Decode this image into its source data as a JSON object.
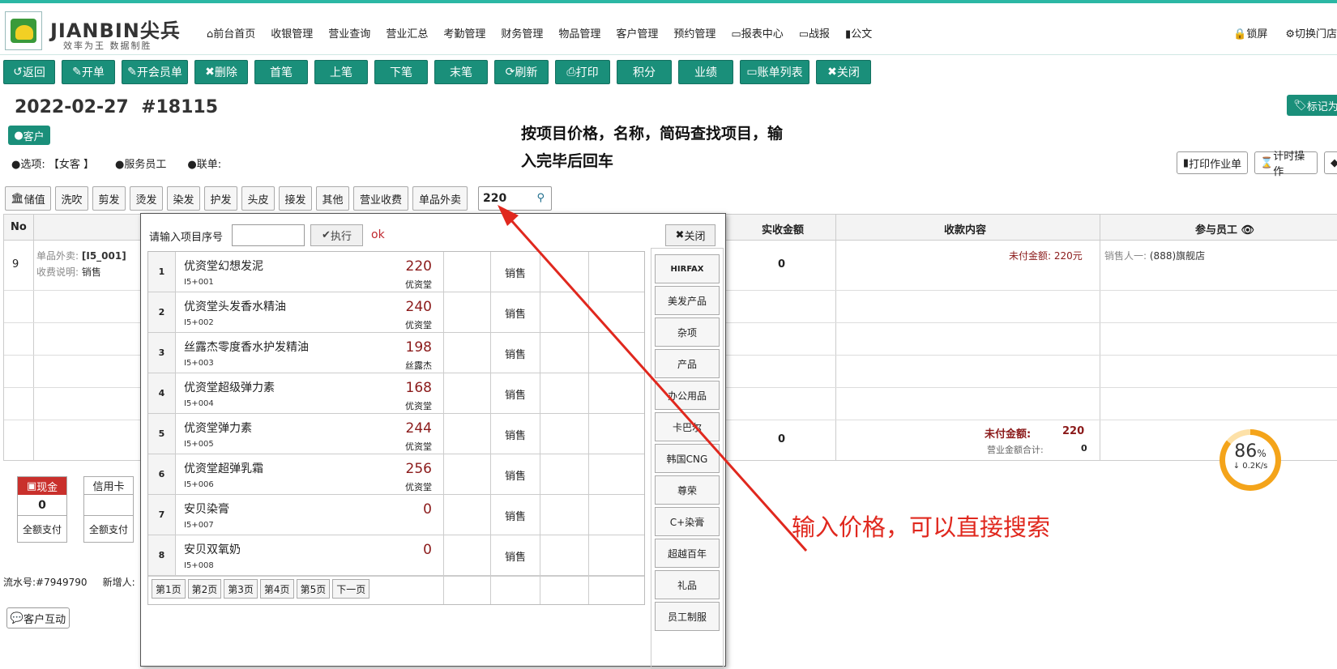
{
  "brand": {
    "name": "JIANBIN尖兵",
    "slogan": "效率为王 数据制胜"
  },
  "nav": [
    "前台首页",
    "收银管理",
    "营业查询",
    "营业汇总",
    "考勤管理",
    "财务管理",
    "物品管理",
    "客户管理",
    "预约管理",
    "报表中心",
    "战报",
    "公文"
  ],
  "header_right": [
    "锁屏",
    "切换门店"
  ],
  "toolbar": [
    "返回",
    "开单",
    "开会员单",
    "删除",
    "首笔",
    "上笔",
    "下笔",
    "末笔",
    "刷新",
    "打印",
    "积分",
    "业绩",
    "账单列表",
    "关闭"
  ],
  "order": {
    "date": "2022-02-27",
    "number": "#18115",
    "mark_label": "标记为"
  },
  "customer_badge": "客户",
  "info": {
    "option": "选项: 【女客 】",
    "staff": "服务员工",
    "linked": "联单:"
  },
  "hint_text": "按项目价格，名称，简码查找项目，输入完毕后回车",
  "right_buttons": [
    "打印作业单",
    "计时操作"
  ],
  "categories": [
    "储值",
    "洗吹",
    "剪发",
    "烫发",
    "染发",
    "护发",
    "头皮",
    "接发",
    "其他",
    "营业收费",
    "单品外卖"
  ],
  "search": {
    "value": "220"
  },
  "main_table": {
    "headers": {
      "no": "No",
      "paid": "实收金额",
      "content": "收款内容",
      "staff": "参与员工"
    },
    "row": {
      "no": "9",
      "item_label": "单品外卖:",
      "item_code": "[I5_001]",
      "fee_label": "收费说明:",
      "fee_value": "销售",
      "paid": "0",
      "unpaid": "未付金额: 220元",
      "seller_label": "销售人一:",
      "seller": "(888)旗舰店"
    },
    "summary": {
      "paid": "0",
      "unpaid_label": "未付金额:",
      "unpaid_value": "220",
      "total_label": "营业金额合计:",
      "total_value": "0"
    }
  },
  "payments": [
    {
      "name": "现金",
      "value": "0",
      "action": "全额支付",
      "active": true
    },
    {
      "name": "信用卡",
      "value": "",
      "action": "全额支付",
      "active": false
    }
  ],
  "serial": {
    "label": "流水号:",
    "value": "#7949790",
    "adder": "新增人:"
  },
  "interact_button": "客户互动",
  "popup": {
    "label": "请输入项目序号",
    "exec": "执行",
    "ok": "ok",
    "close": "关闭",
    "items": [
      {
        "no": "1",
        "name": "优资堂幻想发泥",
        "code": "I5+001",
        "price": "220",
        "brand": "优资堂",
        "type": "销售"
      },
      {
        "no": "2",
        "name": "优资堂头发香水精油",
        "code": "I5+002",
        "price": "240",
        "brand": "优资堂",
        "type": "销售"
      },
      {
        "no": "3",
        "name": "丝露杰零度香水护发精油",
        "code": "I5+003",
        "price": "198",
        "brand": "丝露杰",
        "type": "销售"
      },
      {
        "no": "4",
        "name": "优资堂超级弹力素",
        "code": "I5+004",
        "price": "168",
        "brand": "优资堂",
        "type": "销售"
      },
      {
        "no": "5",
        "name": "优资堂弹力素",
        "code": "I5+005",
        "price": "244",
        "brand": "优资堂",
        "type": "销售"
      },
      {
        "no": "6",
        "name": "优资堂超弹乳霜",
        "code": "I5+006",
        "price": "256",
        "brand": "优资堂",
        "type": "销售"
      },
      {
        "no": "7",
        "name": "安贝染膏",
        "code": "I5+007",
        "price": "0",
        "brand": "",
        "type": "销售"
      },
      {
        "no": "8",
        "name": "安贝双氧奶",
        "code": "I5+008",
        "price": "0",
        "brand": "",
        "type": "销售"
      }
    ],
    "pages": [
      "第1页",
      "第2页",
      "第3页",
      "第4页",
      "第5页",
      "下一页"
    ],
    "categories": [
      "HIRFAX",
      "美发产品",
      "杂项",
      "产品",
      "办公用品",
      "卡巴尔",
      "韩国CNG",
      "尊荣",
      "C+染膏",
      "超越百年",
      "礼品",
      "员工制服"
    ]
  },
  "gauge": {
    "percent": "86",
    "pct_sign": "%",
    "speed": "↓ 0.2K/s"
  },
  "annotation": "输入价格，可以直接搜索",
  "colors": {
    "primary": "#1a8f7a",
    "annotation": "#e0281e",
    "price": "#8b1a1a",
    "gauge": "#f4a41a"
  }
}
